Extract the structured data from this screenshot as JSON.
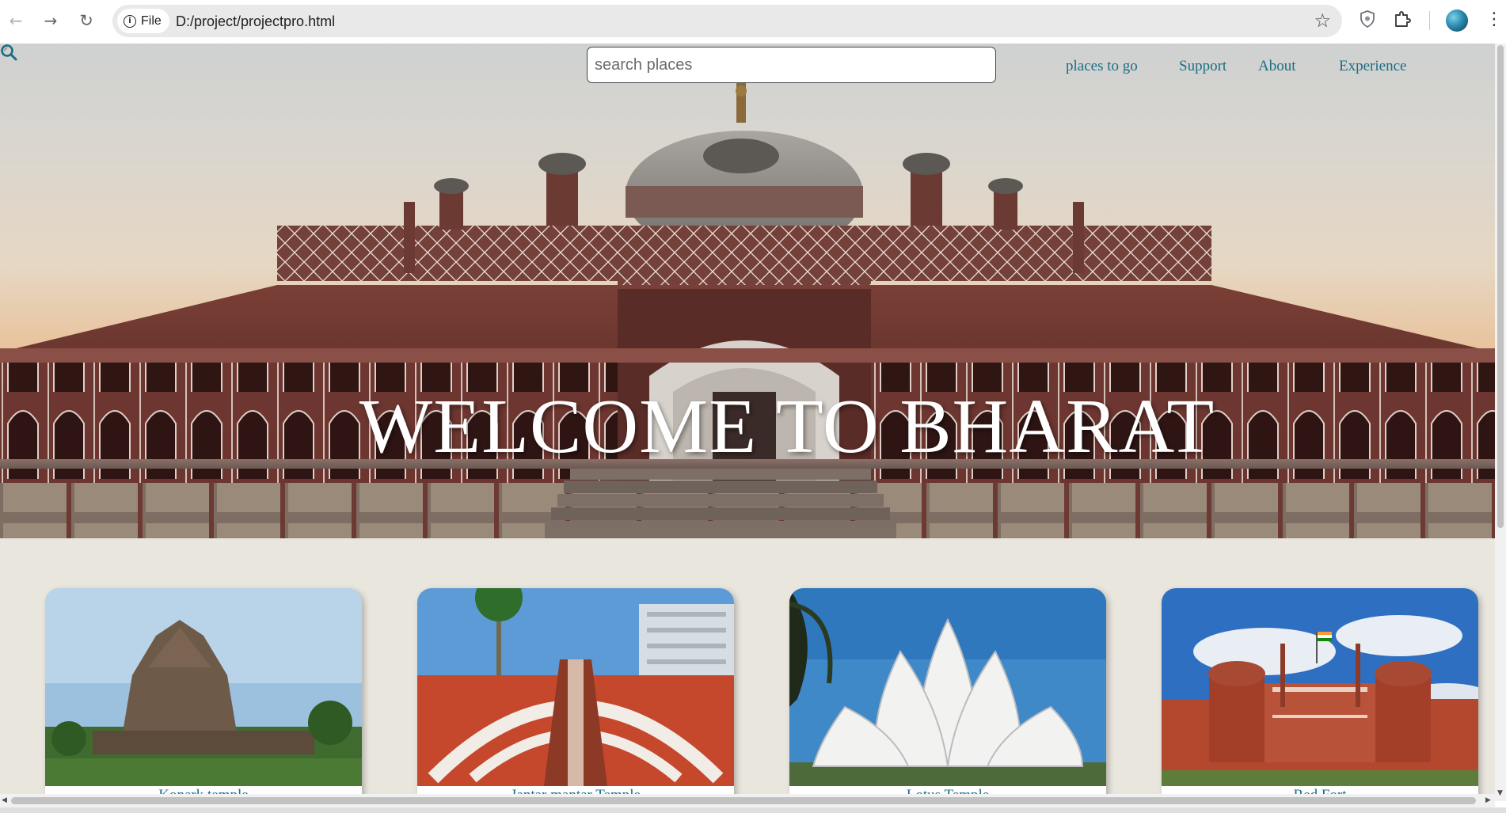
{
  "browser": {
    "back_icon": "arrow-left-icon",
    "forward_icon": "arrow-right-icon",
    "reload_icon": "reload-icon",
    "site_chip_label": "File",
    "url": "D:/project/projectpro.html",
    "bookmark_icon": "star-icon",
    "menu_icon": "kebab-menu-icon"
  },
  "header": {
    "search_placeholder": "search places",
    "nav": [
      {
        "label": "places to go"
      },
      {
        "label": "Support"
      },
      {
        "label": "About"
      },
      {
        "label": "Experience"
      }
    ],
    "link_color": "#1a6e86"
  },
  "hero": {
    "title": "WELCOME TO BHARAT"
  },
  "cards": [
    {
      "caption": "Konark temple"
    },
    {
      "caption": "Jantar mantar Temple"
    },
    {
      "caption": "Lotus Temple"
    },
    {
      "caption": "Red Fort"
    }
  ]
}
